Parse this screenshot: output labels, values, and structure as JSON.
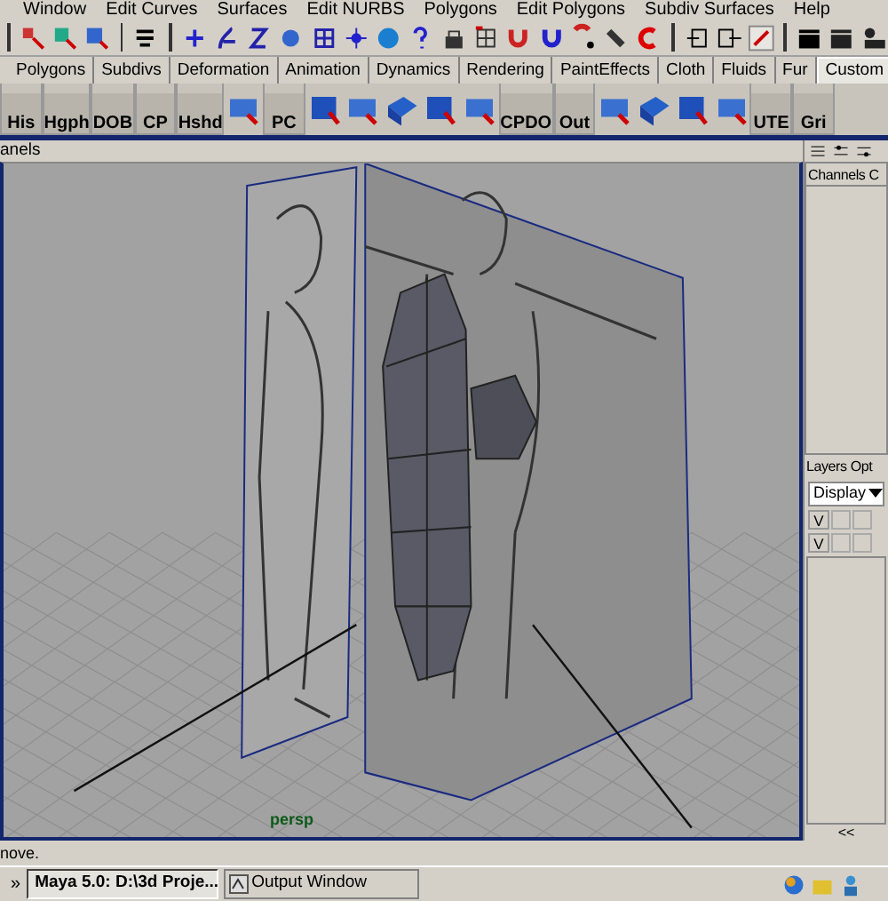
{
  "menu_bar": [
    "Window",
    "Edit Curves",
    "Surfaces",
    "Edit NURBS",
    "Polygons",
    "Edit Polygons",
    "Subdiv Surfaces",
    "Help"
  ],
  "shelf_tabs": [
    {
      "label": "Polygons",
      "selected": false
    },
    {
      "label": "Subdivs",
      "selected": false
    },
    {
      "label": "Deformation",
      "selected": false
    },
    {
      "label": "Animation",
      "selected": false
    },
    {
      "label": "Dynamics",
      "selected": false
    },
    {
      "label": "Rendering",
      "selected": false
    },
    {
      "label": "PaintEffects",
      "selected": false
    },
    {
      "label": "Cloth",
      "selected": false
    },
    {
      "label": "Fluids",
      "selected": false
    },
    {
      "label": "Fur",
      "selected": false
    },
    {
      "label": "Custom",
      "selected": true
    }
  ],
  "shelf_buttons": [
    {
      "kind": "text",
      "label": "His"
    },
    {
      "kind": "text",
      "label": "Hgph"
    },
    {
      "kind": "text",
      "label": "DOB"
    },
    {
      "kind": "text",
      "label": "CP"
    },
    {
      "kind": "text",
      "label": "Hshd"
    },
    {
      "kind": "icon"
    },
    {
      "kind": "text",
      "label": "PC"
    },
    {
      "kind": "icon"
    },
    {
      "kind": "icon"
    },
    {
      "kind": "icon"
    },
    {
      "kind": "icon"
    },
    {
      "kind": "icon"
    },
    {
      "kind": "text",
      "label": "CPDO"
    },
    {
      "kind": "text",
      "label": "Out"
    },
    {
      "kind": "icon"
    },
    {
      "kind": "icon"
    },
    {
      "kind": "icon"
    },
    {
      "kind": "icon"
    },
    {
      "kind": "text",
      "label": "UTE"
    },
    {
      "kind": "text",
      "label": "Gri"
    }
  ],
  "panel_menu": "anels",
  "viewport_label": "persp",
  "channel_box": {
    "tabs": [
      "Channels",
      "C"
    ]
  },
  "layers": {
    "menu": [
      "Layers",
      "Opt"
    ],
    "display": "Display",
    "rows": [
      {
        "visible": "V"
      },
      {
        "visible": "V"
      }
    ],
    "collapse": "<<"
  },
  "help_line": "nove.",
  "taskbar": {
    "chevron": "»",
    "tasks": [
      {
        "label": "Maya 5.0: D:\\3d Proje...",
        "selected": true
      },
      {
        "label": "Output Window",
        "selected": false
      }
    ]
  }
}
